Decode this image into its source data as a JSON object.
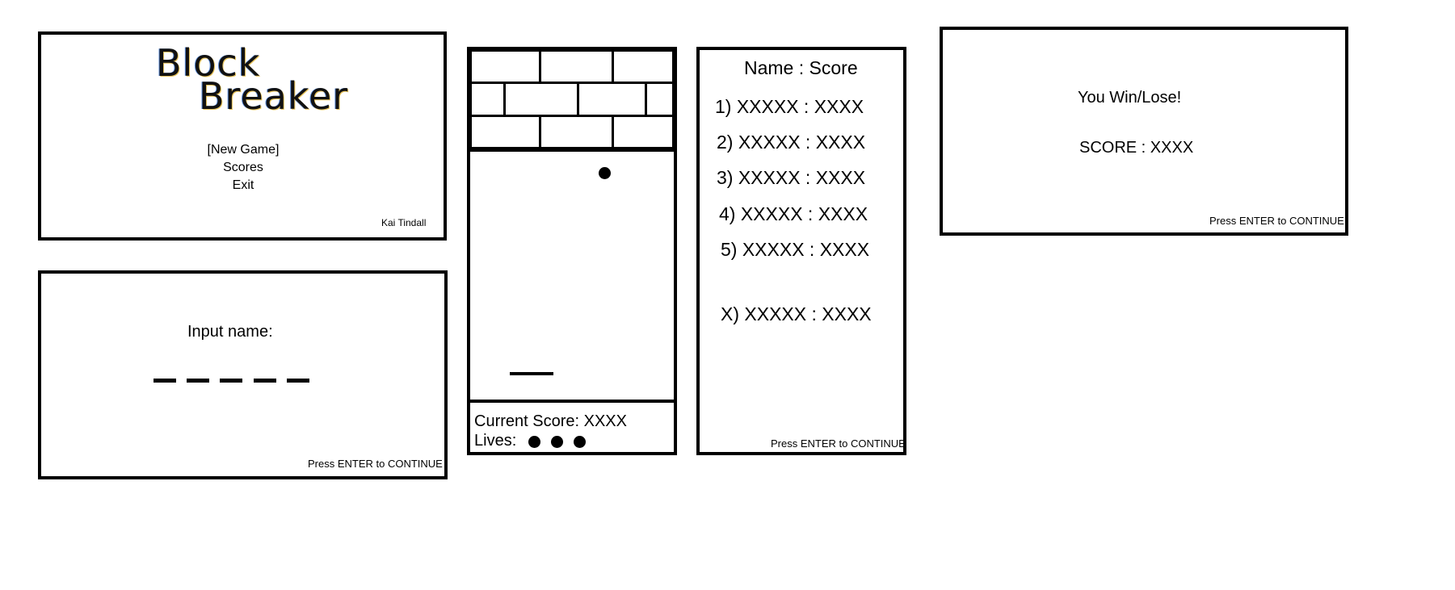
{
  "title_screen": {
    "logo_line1": "Block",
    "logo_line2": "Breaker",
    "menu": [
      "[New Game]",
      "Scores",
      "Exit"
    ],
    "credit": "Kai Tindall"
  },
  "input_screen": {
    "prompt": "Input name:",
    "slots": 5,
    "continue_hint": "Press ENTER to CONTINUE"
  },
  "game_screen": {
    "current_score_label": "Current Score: XXXX",
    "lives_label": "Lives:",
    "lives": 3,
    "brick_rows": 3
  },
  "scores_screen": {
    "header": "Name : Score",
    "entries": [
      "1) XXXXX : XXXX",
      "2) XXXXX : XXXX",
      "3) XXXXX : XXXX",
      "4) XXXXX : XXXX",
      "5) XXXXX : XXXX"
    ],
    "player_entry": "X) XXXXX : XXXX",
    "continue_hint": "Press ENTER to CONTINUE"
  },
  "result_screen": {
    "message": "You Win/Lose!",
    "score": "SCORE : XXXX",
    "continue_hint": "Press ENTER to CONTINUE"
  }
}
